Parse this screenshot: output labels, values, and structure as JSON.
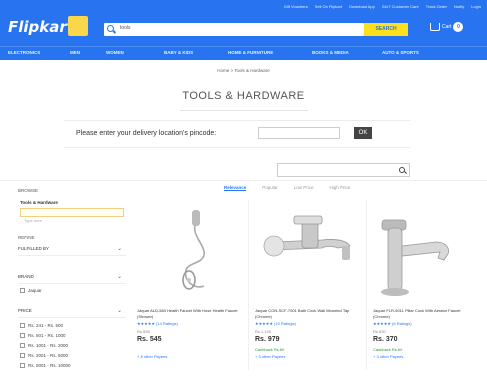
{
  "header": {
    "top_links": [
      "Gift Vouchers",
      "Sell On Flipkart",
      "Download App",
      "24x7 Customer Care",
      "Track Order",
      "Notify",
      "Login"
    ],
    "logo": "Flipkart",
    "search_value": "tools",
    "search_button": "SEARCH",
    "cart_label": "Cart",
    "cart_count": "0"
  },
  "nav": {
    "items": [
      "ELECTRONICS",
      "MEN",
      "WOMEN",
      "BABY & KIDS",
      "HOME & FURNITURE",
      "BOOKS & MEDIA",
      "AUTO & SPORTS"
    ]
  },
  "breadcrumb": "Home > Tools & Hardware",
  "page_title": "TOOLS & HARDWARE",
  "pincode": {
    "label": "Please enter your delivery location's pincode:",
    "button": "OK"
  },
  "sidebar": {
    "browse": "BROWSE",
    "category": "Tools & Hardware",
    "category_search_placeholder": "Type here",
    "refine": "REFINE",
    "fulfilled_by": "FULFILLED BY",
    "brand": "BRAND",
    "brand_option": "Jaquar",
    "price": "PRICE",
    "price_options": [
      "Rs. 241 - Rs. 500",
      "Rs. 501 - Rs. 1000",
      "Rs. 1001 - Rs. 2000",
      "Rs. 2001 - Rs. 5000",
      "Rs. 5001 - Rs. 10000"
    ]
  },
  "sort_tabs": [
    "Relevance",
    "Popular",
    "Low Price",
    "High Price"
  ],
  "products": [
    {
      "name": "Jaquar ALD-583 Health Faucet With Hose Health Faucet (Shower)",
      "rating": "★★★★★ (14 Ratings)",
      "mrp": "Rs.595",
      "price": "Rs. 545",
      "offer": "",
      "more": "+ 8 other Payees"
    },
    {
      "name": "Jaquar CON-SCF-7001 Bath Cock Wall Mounted Tap (Chrome)",
      "rating": "★★★★★ (10 Ratings)",
      "mrp": "Rs.1,135",
      "price": "Rs. 979",
      "offer": "Cashback Rs.60",
      "more": "+ 3 other Payees"
    },
    {
      "name": "Jaquar FLR-5011 Pillar Cock With Aerator Faucet (Chrome)",
      "rating": "★★★★★ (6 Ratings)",
      "mrp": "Rs.530",
      "price": "Rs. 370",
      "offer": "Cashback Rs.60",
      "more": "+ 3 other Payees"
    }
  ],
  "colors": {
    "brand_blue": "#2874f0",
    "search_yellow": "#ffe11b"
  }
}
